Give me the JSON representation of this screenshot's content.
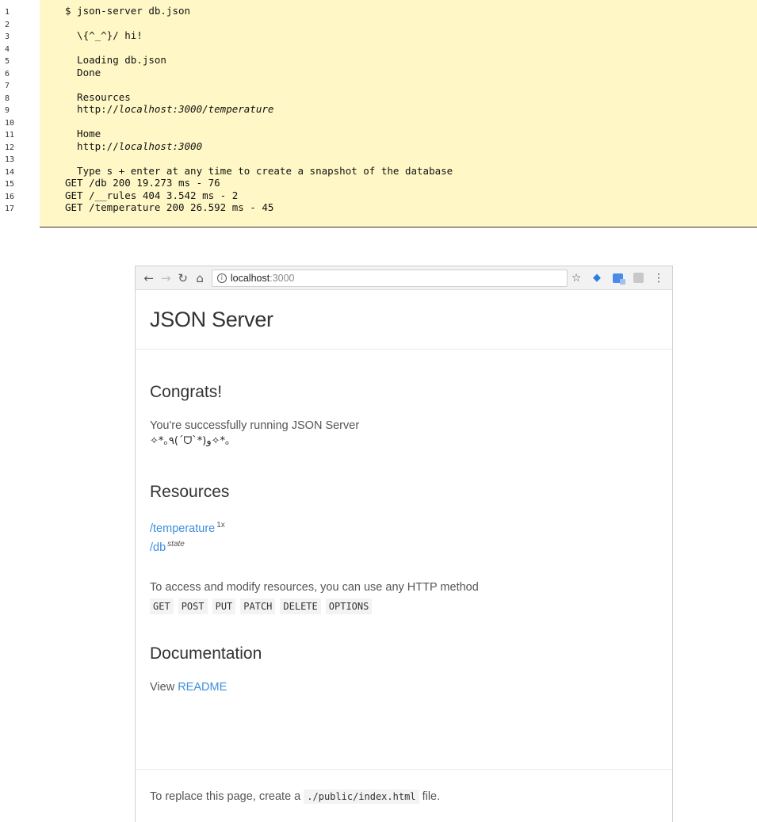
{
  "terminal": {
    "line_numbers": [
      "1",
      "2",
      "3",
      "4",
      "5",
      "6",
      "7",
      "8",
      "9",
      "10",
      "11",
      "12",
      "13",
      "14",
      "15",
      "16",
      "17"
    ],
    "lines": [
      "$ json-server db.json",
      "",
      "  \\{^_^}/ hi!",
      "",
      "  Loading db.json",
      "  Done",
      "",
      "  Resources",
      "",
      "",
      "  Home",
      "",
      "",
      "  Type s + enter at any time to create a snapshot of the database",
      "GET /db 200 19.273 ms - 76",
      "GET /__rules 404 3.542 ms - 2",
      "GET /temperature 200 26.592 ms - 45"
    ],
    "resource_url_prefix": "  http://",
    "resource_url_rest": "localhost:3000/temperature",
    "home_url_prefix": "  http://",
    "home_url_rest": "localhost:3000"
  },
  "browser": {
    "url_host": "localhost",
    "url_port": ":3000",
    "icons": {
      "back": "back-arrow-icon",
      "forward": "forward-arrow-icon",
      "reload": "reload-icon",
      "home": "home-icon",
      "info": "info-icon",
      "star": "star-icon",
      "menu": "kebab-menu-icon"
    }
  },
  "page": {
    "title": "JSON Server",
    "congrats_heading": "Congrats!",
    "running_text": "You're successfully running JSON Server",
    "kaomoji": "✧*｡٩(ˊᗜˋ*)و✧*｡",
    "resources_heading": "Resources",
    "resources": [
      {
        "path": "/temperature",
        "sup": "1x"
      },
      {
        "path": "/db",
        "sup": "state"
      }
    ],
    "access_text": "To access and modify resources, you can use any HTTP method",
    "methods": [
      "GET",
      "POST",
      "PUT",
      "PATCH",
      "DELETE",
      "OPTIONS"
    ],
    "docs_heading": "Documentation",
    "view_prefix": "View ",
    "readme_label": "README",
    "footer_prefix": "To replace this page, create a ",
    "footer_code": "./public/index.html",
    "footer_suffix": " file."
  },
  "colors": {
    "code_bg": "#fff8c6",
    "link": "#3d8ede",
    "ext_blue": "#2c7de0"
  }
}
